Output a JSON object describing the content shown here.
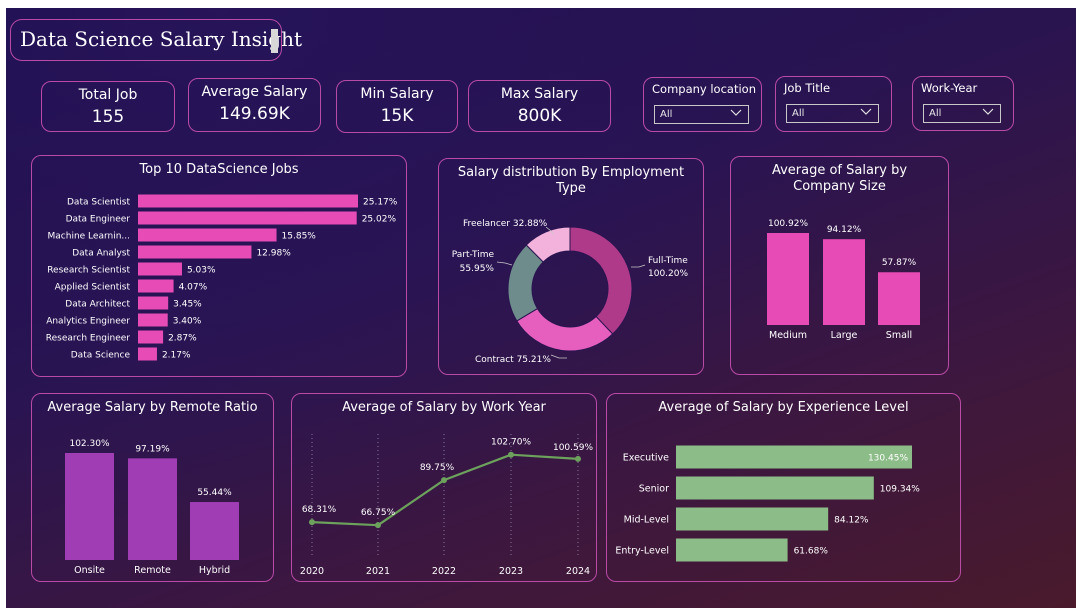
{
  "header": {
    "title": "Data Science Salary Insight"
  },
  "kpis": [
    {
      "label": "Total Job",
      "value": "155"
    },
    {
      "label": "Average Salary",
      "value": "149.69K"
    },
    {
      "label": "Min Salary",
      "value": "15K"
    },
    {
      "label": "Max Salary",
      "value": "800K"
    }
  ],
  "filters": [
    {
      "label": "Company location",
      "value": "All"
    },
    {
      "label": "Job Title",
      "value": "All"
    },
    {
      "label": "Work-Year",
      "value": "All"
    }
  ],
  "colors": {
    "pink": "#e74bb5",
    "purple": "#a03cb4",
    "green": "#8cbc87",
    "line": "#6ca25c",
    "border": "#b94aa6"
  },
  "chart_data": [
    {
      "id": "top_jobs",
      "type": "bar",
      "orientation": "horizontal",
      "title": "Top 10 DataScience Jobs",
      "categories": [
        "Data Scientist",
        "Data Engineer",
        "Machine Learnin...",
        "Data Analyst",
        "Research Scientist",
        "Applied Scientist",
        "Data Architect",
        "Analytics Engineer",
        "Research Engineer",
        "Data Science"
      ],
      "values": [
        25.17,
        25.02,
        15.85,
        12.98,
        5.03,
        4.07,
        3.45,
        3.4,
        2.87,
        2.17
      ],
      "labels": [
        "25.17%",
        "25.02%",
        "15.85%",
        "12.98%",
        "5.03%",
        "4.07%",
        "3.45%",
        "3.40%",
        "2.87%",
        "2.17%"
      ]
    },
    {
      "id": "employment_type",
      "type": "pie",
      "donut": true,
      "title": "Salary distribution By Employment Type",
      "categories": [
        "Full-Time",
        "Contract",
        "Part-Time",
        "Freelancer"
      ],
      "values": [
        100.2,
        75.21,
        55.95,
        32.88
      ],
      "labels": [
        "100.20%",
        "75.21%",
        "55.95%",
        "32.88%"
      ],
      "colors": [
        "#b03a8a",
        "#e75fbe",
        "#6e8c8c",
        "#f2b2dc"
      ]
    },
    {
      "id": "company_size",
      "type": "bar",
      "title": "Average of Salary by Company Size",
      "categories": [
        "Medium",
        "Large",
        "Small"
      ],
      "values": [
        100.92,
        94.12,
        57.87
      ],
      "labels": [
        "100.92%",
        "94.12%",
        "57.87%"
      ]
    },
    {
      "id": "remote_ratio",
      "type": "bar",
      "title": "Average Salary by Remote Ratio",
      "categories": [
        "Onsite",
        "Remote",
        "Hybrid"
      ],
      "values": [
        102.3,
        97.19,
        55.44
      ],
      "labels": [
        "102.30%",
        "97.19%",
        "55.44%"
      ]
    },
    {
      "id": "work_year",
      "type": "line",
      "title": "Average of Salary by Work Year",
      "x": [
        "2020",
        "2021",
        "2022",
        "2023",
        "2024"
      ],
      "values": [
        68.31,
        66.75,
        89.75,
        102.7,
        100.59
      ],
      "labels": [
        "68.31%",
        "66.75%",
        "89.75%",
        "102.70%",
        "100.59%"
      ]
    },
    {
      "id": "experience",
      "type": "bar",
      "orientation": "horizontal",
      "title": "Average of Salary by Experience Level",
      "categories": [
        "Executive",
        "Senior",
        "Mid-Level",
        "Entry-Level"
      ],
      "values": [
        130.45,
        109.34,
        84.12,
        61.68
      ],
      "labels": [
        "130.45%",
        "109.34%",
        "84.12%",
        "61.68%"
      ]
    }
  ]
}
